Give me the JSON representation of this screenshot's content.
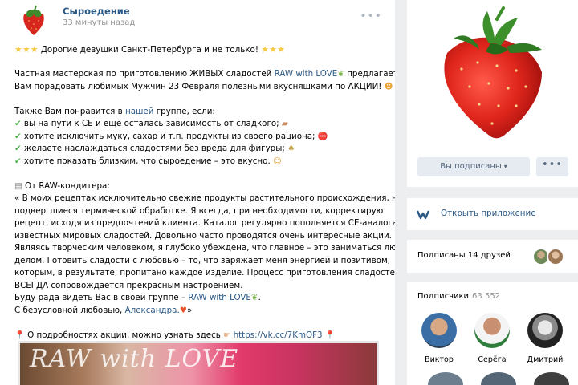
{
  "post": {
    "author": "Сыроедение",
    "time": "33 минуты назад",
    "more": "•••",
    "lines": {
      "title": "Дорогие девушки Санкт-Петербурга и не только!",
      "p1a": "Частная мастерская по приготовлению ЖИВЫХ сладостей",
      "p1_link": "RAW with LOVE",
      "p1b": "предлагает",
      "p2": "Вам порадовать любимых Мужчин 23 Февраля полезными вкусняшками по АКЦИИ!",
      "p3a": "Также Вам понравится в",
      "p3_link": "нашей",
      "p3b": "группе, если:",
      "c1": "вы на пути к СЕ и ещё осталась зависимость от сладкого;",
      "c2": "хотите исключить муку, сахар и т.п. продукты из своего рациона;",
      "c3": "желаете наслаждаться сладостями без вреда для фигуры;",
      "c4": "хотите показать близким, что сыроедение – это вкусно.",
      "from": "От RAW-кондитера:",
      "q1": "«  В моих рецептах исключительно свежие продукты растительного происхождения, не",
      "q2": "подвергшиеся термической обработке.  Я всегда, при необходимости, корректирую",
      "q3": "рецепт, исходя из предпочтений клиента.  Каталог регулярно пополняется СЕ-аналогами",
      "q4": "известных мировых сладостей.  Довольно часто проводятся очень интересные акции.",
      "q5": "Являясь творческим человеком, я глубоко убеждена, что главное – это заниматься любимым",
      "q6": "делом.  Готовить сладости с любовью – то, что заряжает меня энергией и позитивом,",
      "q7": "которым, в результате, пропитано каждое изделие.  Процесс приготовления сладостей",
      "q8": "ВСЕГДА сопровождается прекрасным настроением.",
      "q9a": "Буду рада видеть Вас в своей группе –",
      "q9_link": "RAW with LOVE",
      "q10a": "С безусловной любовью,",
      "q10_link": "Александра.",
      "q10b": "»",
      "promo_a": "О подробностях акции, можно узнать здесь",
      "promo_link": "https://vk.cc/7KmOF3"
    },
    "image_text": "RAW with LOVE"
  },
  "sidebar": {
    "subscribed_label": "Вы подписаны",
    "more": "•••",
    "app_label": "Открыть приложение",
    "friends_label": "Подписаны 14 друзей",
    "members_title": "Подписчики",
    "members_count": "63 552",
    "members": [
      {
        "name": "Виктор"
      },
      {
        "name": "Серёга"
      },
      {
        "name": "Дмитрий"
      }
    ]
  },
  "colors": {
    "link": "#2a5885",
    "background": "#edeef0",
    "button_bg": "#e5ebf1"
  }
}
